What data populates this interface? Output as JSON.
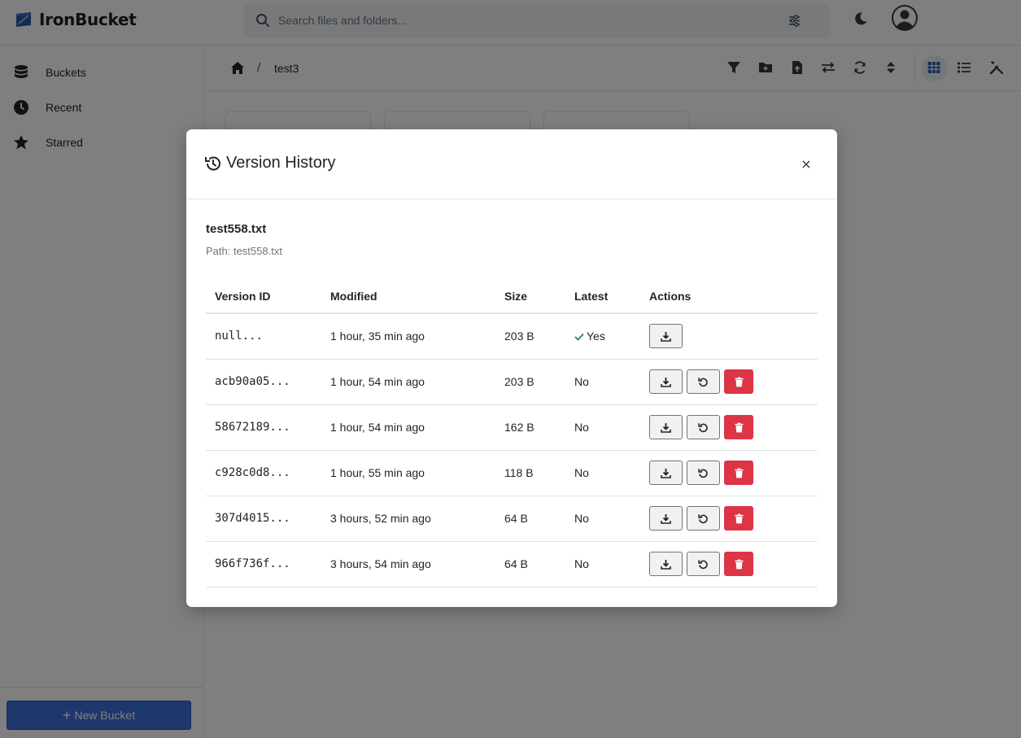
{
  "app": {
    "name": "IronBucket",
    "brand_color": "#2b5aa8"
  },
  "search": {
    "placeholder": "Search files and folders..."
  },
  "sidebar": {
    "items": [
      {
        "label": "Buckets",
        "icon": "database-icon"
      },
      {
        "label": "Recent",
        "icon": "clock-icon"
      },
      {
        "label": "Starred",
        "icon": "star-icon"
      }
    ],
    "new_bucket_label": "New Bucket"
  },
  "breadcrumb": {
    "current": "test3",
    "separator": "/"
  },
  "toolbar": {
    "icons": [
      "filter-icon",
      "new-folder-icon",
      "upload-file-icon",
      "transfer-icon",
      "refresh-icon",
      "sort-icon",
      "grid-view-icon",
      "list-view-icon",
      "tools-icon"
    ],
    "active_view": "grid-view-icon"
  },
  "modal": {
    "title": "Version History",
    "close_label": "×",
    "file_name": "test558.txt",
    "file_path": "Path: test558.txt",
    "columns": [
      "Version ID",
      "Modified",
      "Size",
      "Latest",
      "Actions"
    ],
    "rows": [
      {
        "version_id": "null...",
        "modified": "1 hour, 35 min ago",
        "size": "203 B",
        "latest": "Yes",
        "is_latest": true
      },
      {
        "version_id": "acb90a05...",
        "modified": "1 hour, 54 min ago",
        "size": "203 B",
        "latest": "No",
        "is_latest": false
      },
      {
        "version_id": "58672189...",
        "modified": "1 hour, 54 min ago",
        "size": "162 B",
        "latest": "No",
        "is_latest": false
      },
      {
        "version_id": "c928c0d8...",
        "modified": "1 hour, 55 min ago",
        "size": "118 B",
        "latest": "No",
        "is_latest": false
      },
      {
        "version_id": "307d4015...",
        "modified": "3 hours, 52 min ago",
        "size": "64 B",
        "latest": "No",
        "is_latest": false
      },
      {
        "version_id": "966f736f...",
        "modified": "3 hours, 54 min ago",
        "size": "64 B",
        "latest": "No",
        "is_latest": false
      }
    ]
  },
  "colors": {
    "accent": "#3d6edb",
    "success": "#198754",
    "danger": "#dc3545"
  }
}
